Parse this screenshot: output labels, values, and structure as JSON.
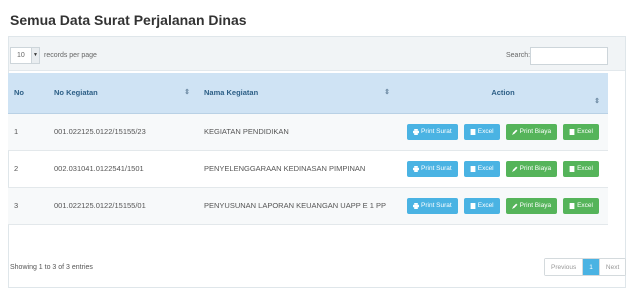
{
  "page": {
    "title": "Semua Data Surat Perjalanan Dinas"
  },
  "toolbar": {
    "length_value": "10",
    "length_label": "records per page",
    "search_label": "Search:",
    "search_value": ""
  },
  "table": {
    "headers": {
      "no": "No",
      "no_kegiatan": "No Kegiatan",
      "nama_kegiatan": "Nama Kegiatan",
      "action": "Action"
    },
    "rows": [
      {
        "no": "1",
        "no_kegiatan": "001.022125.0122/15155/23",
        "nama_kegiatan": "KEGIATAN PENDIDIKAN"
      },
      {
        "no": "2",
        "no_kegiatan": "002.031041.0122541/1501",
        "nama_kegiatan": "PENYELENGGARAAN KEDINASAN PIMPINAN"
      },
      {
        "no": "3",
        "no_kegiatan": "001.022125.0122/15155/01",
        "nama_kegiatan": "PENYUSUNAN LAPORAN KEUANGAN UAPP E 1 PP"
      }
    ],
    "row_actions": {
      "print_surat": "Print Surat",
      "excel": "Excel",
      "print_biaya": "Print Biaya"
    }
  },
  "footer": {
    "info": "Showing 1 to 3 of 3 entries",
    "previous": "Previous",
    "current_page": "1",
    "next": "Next"
  },
  "colors": {
    "header_bg": "#cfe3f4",
    "btn_blue": "#4ab3e3",
    "btn_green": "#55b45a"
  }
}
